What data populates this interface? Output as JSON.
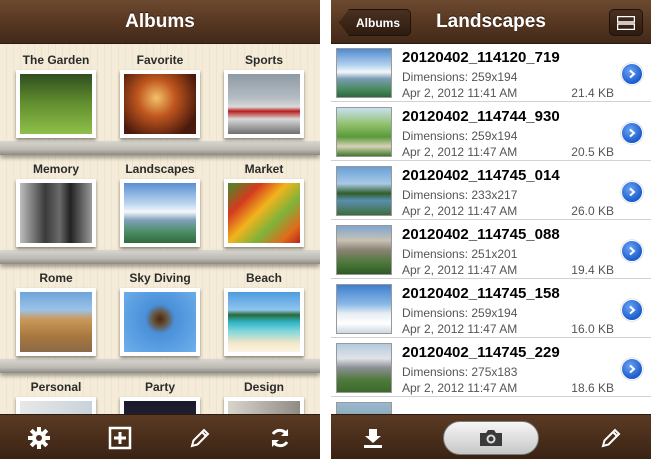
{
  "left": {
    "title": "Albums",
    "albums": [
      {
        "label": "The Garden"
      },
      {
        "label": "Favorite"
      },
      {
        "label": "Sports"
      },
      {
        "label": "Memory"
      },
      {
        "label": "Landscapes"
      },
      {
        "label": "Market"
      },
      {
        "label": "Rome"
      },
      {
        "label": "Sky Diving"
      },
      {
        "label": "Beach"
      },
      {
        "label": "Personal"
      },
      {
        "label": "Party"
      },
      {
        "label": "Design"
      }
    ],
    "toolbar_icons": [
      "gear-icon",
      "add-album-icon",
      "pencil-icon",
      "refresh-icon"
    ]
  },
  "right": {
    "title": "Landscapes",
    "back_label": "Albums",
    "photos": [
      {
        "name": "20120402_114120_719",
        "dimensions": "Dimensions: 259x194",
        "date": "Apr 2, 2012 11:41 AM",
        "size": "21.4 KB"
      },
      {
        "name": "20120402_114744_930",
        "dimensions": "Dimensions: 259x194",
        "date": "Apr 2, 2012 11:47 AM",
        "size": "20.5 KB"
      },
      {
        "name": "20120402_114745_014",
        "dimensions": "Dimensions: 233x217",
        "date": "Apr 2, 2012 11:47 AM",
        "size": "26.0 KB"
      },
      {
        "name": "20120402_114745_088",
        "dimensions": "Dimensions: 251x201",
        "date": "Apr 2, 2012 11:47 AM",
        "size": "19.4 KB"
      },
      {
        "name": "20120402_114745_158",
        "dimensions": "Dimensions: 259x194",
        "date": "Apr 2, 2012 11:47 AM",
        "size": "16.0 KB"
      },
      {
        "name": "20120402_114745_229",
        "dimensions": "Dimensions: 275x183",
        "date": "Apr 2, 2012 11:47 AM",
        "size": "18.6 KB"
      }
    ],
    "toolbar_icons": [
      "download-icon",
      "camera-icon",
      "pencil-icon"
    ]
  },
  "colors": {
    "leather": "#553620",
    "shelf_paper": "#f4ecd8",
    "disclosure_blue": "#1a5ccc"
  }
}
